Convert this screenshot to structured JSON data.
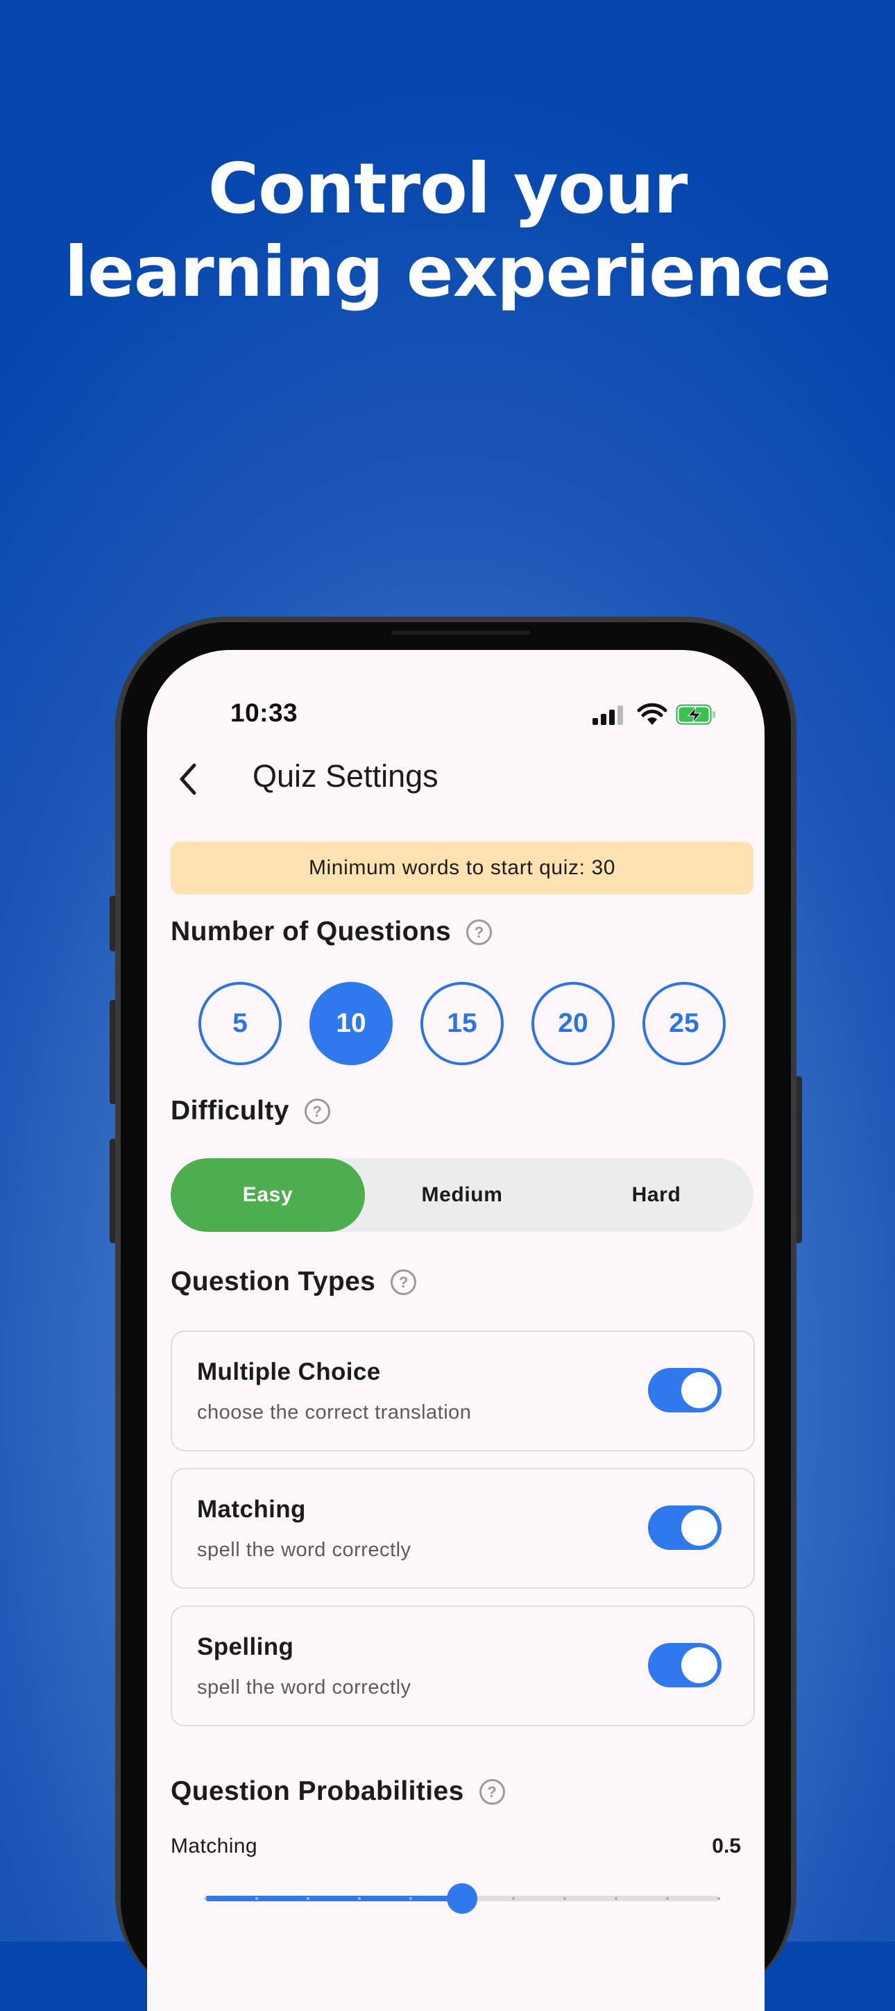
{
  "headline": {
    "line1": "Control your",
    "line2": "learning experience"
  },
  "status_bar": {
    "time": "10:33"
  },
  "nav": {
    "title": "Quiz Settings",
    "back_icon": "chevron-left-icon"
  },
  "banner": {
    "text": "Minimum words to start quiz: 30",
    "color": "#ffe2b2"
  },
  "questions": {
    "heading": "Number of Questions",
    "options": [
      "5",
      "10",
      "15",
      "20",
      "25"
    ],
    "selected": "10"
  },
  "difficulty": {
    "heading": "Difficulty",
    "options": [
      "Easy",
      "Medium",
      "Hard"
    ],
    "selected": "Easy"
  },
  "question_types": {
    "heading": "Question Types",
    "items": [
      {
        "name": "Multiple Choice",
        "desc": "choose the correct translation",
        "enabled": true
      },
      {
        "name": "Matching",
        "desc": "spell the word correctly",
        "enabled": true
      },
      {
        "name": "Spelling",
        "desc": "spell the word correctly",
        "enabled": true
      }
    ]
  },
  "probabilities": {
    "heading": "Question Probabilities",
    "slider_label": "Matching",
    "value_text": "0.5",
    "value": 0.5
  },
  "colors": {
    "accent": "#2f78ee",
    "easy": "#4cae4f",
    "background": "#0446ae"
  }
}
